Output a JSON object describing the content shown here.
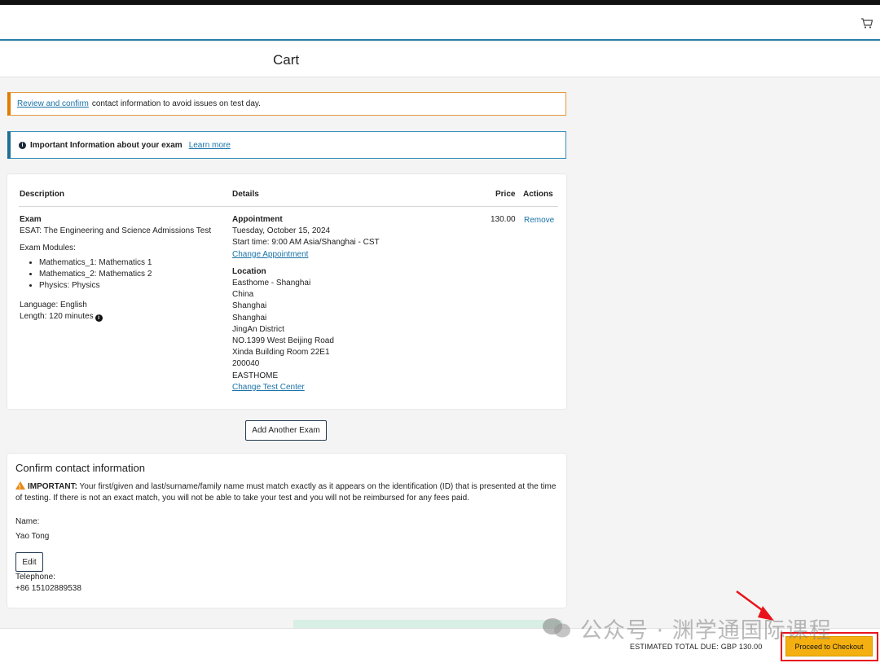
{
  "header": {
    "cart_icon": "cart-icon"
  },
  "page": {
    "title": "Cart"
  },
  "alerts": {
    "contact": {
      "link": "Review and confirm",
      "text": "contact information to avoid issues on test day."
    },
    "exam_info": {
      "icon": "info-icon",
      "text": "Important Information about your exam",
      "link": "Learn more"
    }
  },
  "cart": {
    "headers": {
      "description": "Description",
      "details": "Details",
      "price": "Price",
      "actions": "Actions"
    },
    "item": {
      "type": "Exam",
      "name": "ESAT: The Engineering and Science Admissions Test",
      "modules_label": "Exam Modules:",
      "modules": [
        "Mathematics_1: Mathematics 1",
        "Mathematics_2: Mathematics 2",
        "Physics: Physics"
      ],
      "language": "Language: English",
      "length": "Length: 120 minutes",
      "appointment_label": "Appointment",
      "date": "Tuesday, October 15, 2024",
      "start_time": "Start time: 9:00 AM Asia/Shanghai - CST",
      "change_appointment": "Change Appointment",
      "location_label": "Location",
      "location_lines": [
        "Easthome - Shanghai",
        "China",
        "Shanghai",
        "Shanghai",
        "JingAn District",
        "NO.1399 West Beijing Road",
        "Xinda Building Room 22E1",
        "200040",
        "EASTHOME"
      ],
      "change_test_center": "Change Test Center",
      "price": "130.00",
      "remove": "Remove"
    },
    "add_another": "Add Another Exam"
  },
  "contact": {
    "title": "Confirm contact information",
    "important_label": "IMPORTANT:",
    "important_text": "Your first/given and last/surname/family name must match exactly as it appears on the identification (ID) that is presented at the time of testing. If there is not an exact match, you will not be able to take your test and you will not be reimbursed for any fees paid.",
    "name_label": "Name:",
    "name_value": "Yao Tong",
    "edit": "Edit",
    "telephone_label": "Telephone:",
    "telephone_value": "+86 15102889538"
  },
  "footer": {
    "total": "ESTIMATED TOTAL DUE: GBP 130.00",
    "checkout": "Proceed to Checkout"
  },
  "watermark": {
    "text": "公众号 · 渊学通国际课程"
  },
  "colors": {
    "accent": "#2a7fa8",
    "checkout": "#f4b011",
    "warning": "#e07b00",
    "highlight": "#e8141c"
  }
}
